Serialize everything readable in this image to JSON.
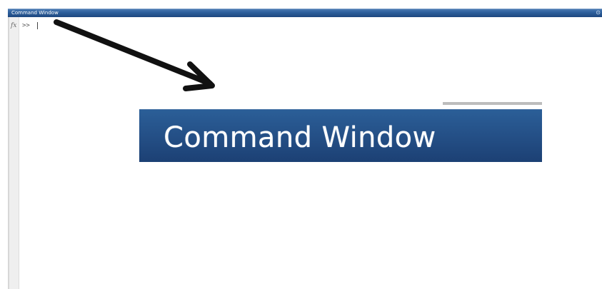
{
  "window": {
    "title": "Command Window",
    "title_glyph": "⊙"
  },
  "command_area": {
    "fx_label": "fx",
    "prompt": ">>"
  },
  "callout": {
    "title": "Command Window"
  },
  "colors": {
    "titlebar_blue": "#2d5f9c",
    "zoom_blue": "#244f86",
    "gutter_gray": "#efefef",
    "arrow_black": "#111111"
  },
  "icons": {
    "fx": "fx-icon",
    "arrow": "arrow-pointer-icon"
  }
}
